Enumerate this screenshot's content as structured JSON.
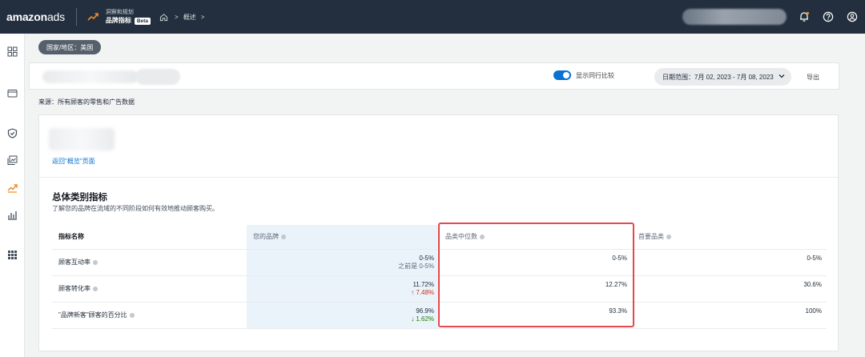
{
  "topbar": {
    "logo_bold": "amazon",
    "logo_light": "ads",
    "app_subtitle": "洞察和规划",
    "app_title": "品牌指标",
    "beta": "Beta",
    "crumb_sep": ">",
    "crumb": "概述",
    "crumb_sep2": ">"
  },
  "chip": {
    "label": "国家/地区：美国"
  },
  "filterbar": {
    "toggle_label": "显示同行比较",
    "date_range": "日期范围：7月 02, 2023 - 7月 08, 2023",
    "export": "导出"
  },
  "source": "来源：所有顾客的零售和广告数据",
  "card": {
    "back_link": "返回\"概览\"页面",
    "section_title": "总体类别指标",
    "section_subtitle": "了解您的品牌在流域的不同阶段如何有效地推动顾客购买。"
  },
  "table": {
    "headers": [
      "指标名称",
      "您的品牌",
      "品类中位数",
      "首要品类"
    ],
    "rows": [
      {
        "name": "顾客互动率",
        "brand": "0-5%",
        "brand_sub": "之前是 0-5%",
        "brand_sub_kind": "muted",
        "median": "0-5%",
        "top": "0-5%"
      },
      {
        "name": "顾客转化率",
        "brand": "11.72%",
        "brand_sub": "↑ 7.48%",
        "brand_sub_kind": "up",
        "median": "12.27%",
        "top": "30.6%"
      },
      {
        "name": "\"品牌新客\"顾客的百分比",
        "brand": "96.9%",
        "brand_sub": "↓ 1.62%",
        "brand_sub_kind": "down",
        "median": "93.3%",
        "top": "100%"
      }
    ]
  },
  "colors": {
    "topbar": "#232f3e",
    "accent": "#0972d3",
    "highlight": "#e5484d",
    "up": "#d13212",
    "down": "#1d8102"
  }
}
